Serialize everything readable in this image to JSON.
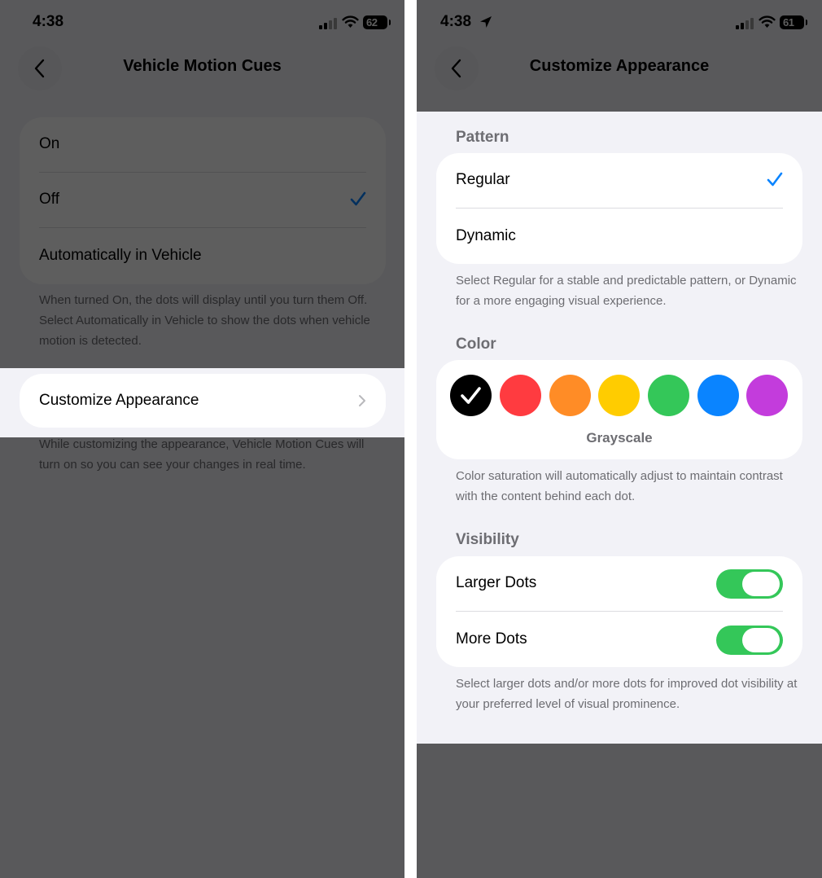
{
  "left": {
    "status": {
      "time": "4:38",
      "battery": "62"
    },
    "nav": {
      "title": "Vehicle Motion Cues"
    },
    "options": [
      {
        "label": "On",
        "selected": false
      },
      {
        "label": "Off",
        "selected": true
      },
      {
        "label": "Automatically in Vehicle",
        "selected": false
      }
    ],
    "options_footnote": "When turned On, the dots will display until you turn them Off. Select Automatically in Vehicle to show the dots when vehicle motion is detected.",
    "customize_label": "Customize Appearance",
    "customize_footnote": "While customizing the appearance, Vehicle Motion Cues will turn on so you can see your changes in real time."
  },
  "right": {
    "status": {
      "time": "4:38",
      "battery": "61"
    },
    "nav": {
      "title": "Customize Appearance"
    },
    "pattern": {
      "header": "Pattern",
      "options": [
        {
          "label": "Regular",
          "selected": true
        },
        {
          "label": "Dynamic",
          "selected": false
        }
      ],
      "footnote": "Select Regular for a stable and predictable pattern, or Dynamic for a more engaging visual experience."
    },
    "color": {
      "header": "Color",
      "swatches": [
        "#000000",
        "#ff3b40",
        "#ff8c26",
        "#ffcc00",
        "#34c759",
        "#0a84ff",
        "#c33cdc"
      ],
      "selected_index": 0,
      "selected_name": "Grayscale",
      "footnote": "Color saturation will automatically adjust to maintain contrast with the content behind each dot."
    },
    "visibility": {
      "header": "Visibility",
      "toggles": [
        {
          "label": "Larger Dots",
          "on": true
        },
        {
          "label": "More Dots",
          "on": true
        }
      ],
      "footnote": "Select larger dots and/or more dots for improved dot visibility at your preferred level of visual prominence."
    }
  },
  "colors": {
    "accent": "#0a84ff",
    "toggle_on": "#34c759",
    "background": "#f2f2f7",
    "secondary_text": "#6d6d72"
  }
}
